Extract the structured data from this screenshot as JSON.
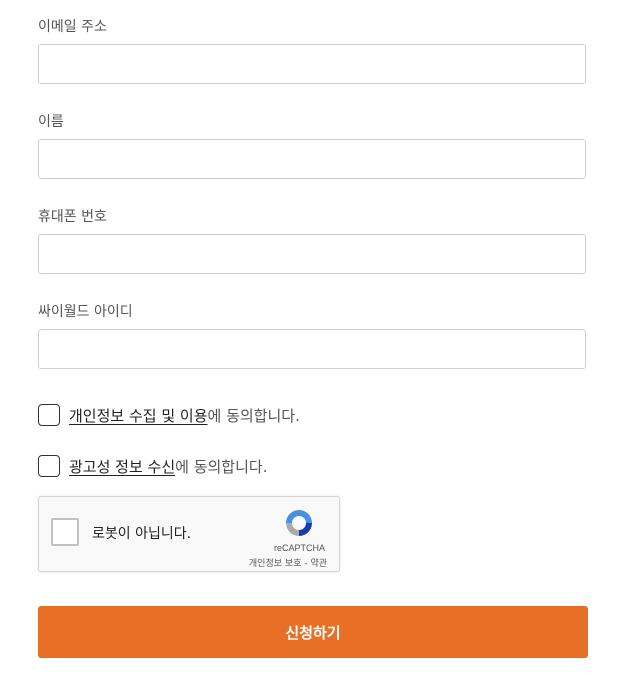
{
  "form": {
    "email": {
      "label": "이메일 주소",
      "value": "",
      "placeholder": ""
    },
    "name": {
      "label": "이름",
      "value": "",
      "placeholder": ""
    },
    "phone": {
      "label": "휴대폰 번호",
      "value": "",
      "placeholder": ""
    },
    "cyworld_id": {
      "label": "싸이월드 아이디",
      "value": "",
      "placeholder": ""
    }
  },
  "consents": {
    "privacy": {
      "link_text": "개인정보 수집 및 이용",
      "suffix": "에 동의합니다.",
      "checked": false
    },
    "marketing": {
      "link_text": "광고성 정보 수신",
      "suffix": "에 동의합니다.",
      "checked": false
    }
  },
  "recaptcha": {
    "label": "로봇이 아닙니다.",
    "brand": "reCAPTCHA",
    "privacy_link": "개인정보 보호",
    "separator": " - ",
    "terms_link": "약관",
    "icon": "recaptcha-logo"
  },
  "submit": {
    "label": "신청하기"
  },
  "colors": {
    "accent": "#e76f26",
    "border": "#cfcfcf",
    "text": "#555555"
  }
}
